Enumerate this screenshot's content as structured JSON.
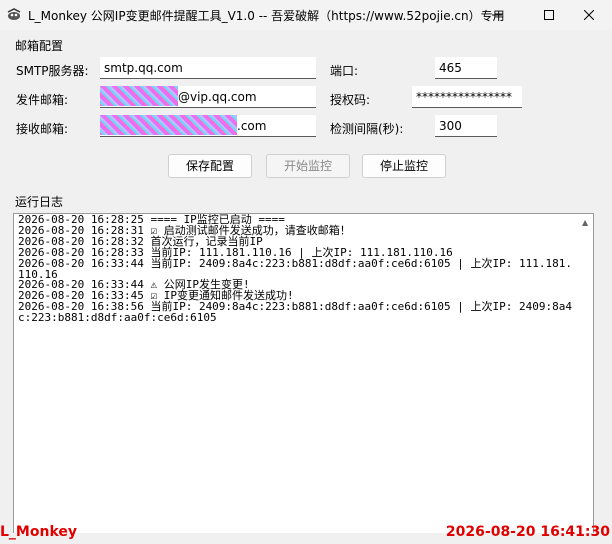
{
  "window": {
    "title": "L_Monkey 公网IP变更邮件提醒工具_V1.0 -- 吾爱破解（https://www.52pojie.cn）专用",
    "icon": "app-logo-icon"
  },
  "mail_config": {
    "group_title": "邮箱配置",
    "smtp_label": "SMTP服务器:",
    "smtp_value": "smtp.qq.com",
    "port_label": "端口:",
    "port_value": "465",
    "sender_label": "发件邮箱:",
    "sender_value": "@vip.qq.com",
    "auth_label": "授权码:",
    "auth_value": "****************",
    "receiver_label": "接收邮箱:",
    "receiver_value": ".com",
    "interval_label": "检测间隔(秒):",
    "interval_value": "300"
  },
  "buttons": {
    "save": "保存配置",
    "start": "开始监控",
    "stop": "停止监控"
  },
  "log": {
    "group_title": "运行日志",
    "lines": [
      "2026-08-20 16:28:25 ==== IP监控已启动 ====",
      "2026-08-20 16:28:31 ☑ 启动测试邮件发送成功，请查收邮箱！",
      "2026-08-20 16:28:32 首次运行，记录当前IP",
      "2026-08-20 16:28:33 当前IP: 111.181.110.16 | 上次IP: 111.181.110.16",
      "2026-08-20 16:33:44 当前IP: 2409:8a4c:223:b881:d8df:aa0f:ce6d:6105 | 上次IP: 111.181.110.16",
      "2026-08-20 16:33:44 ⚠ 公网IP发生变更!",
      "2026-08-20 16:33:45 ☑ IP变更通知邮件发送成功!",
      "2026-08-20 16:38:56 当前IP: 2409:8a4c:223:b881:d8df:aa0f:ce6d:6105 | 上次IP: 2409:8a4c:223:b881:d8df:aa0f:ce6d:6105"
    ]
  },
  "footer": {
    "author": "L_Monkey",
    "clock": "2026-08-20 16:41:30"
  },
  "colors": {
    "footer_text": "#e00000"
  }
}
